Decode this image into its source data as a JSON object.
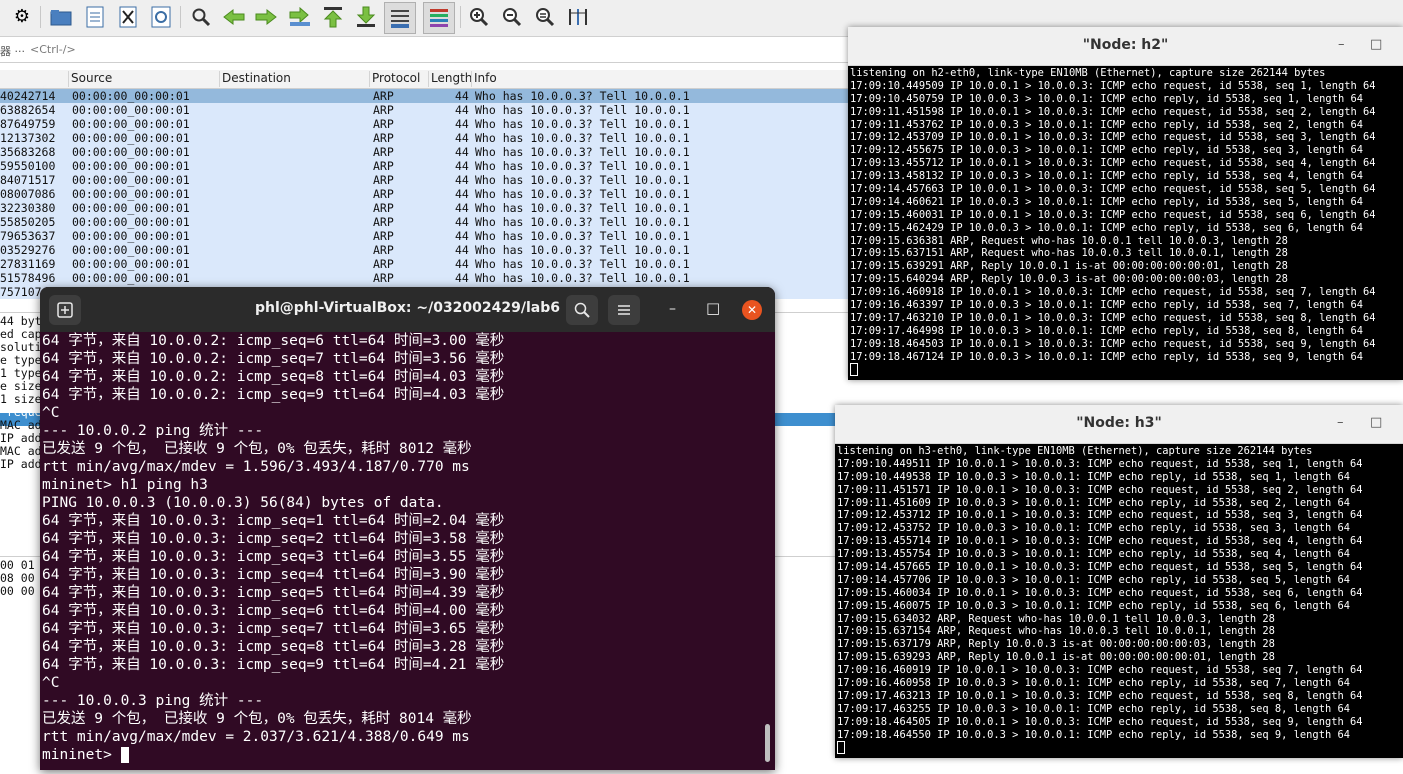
{
  "wireshark": {
    "toolbar_icons": [
      "gear-icon",
      "open-folder-icon",
      "file-icon",
      "close-file-icon",
      "reload-icon",
      "search-icon",
      "arrow-left-icon",
      "arrow-right-icon",
      "go-to-packet-icon",
      "first-packet-icon",
      "last-packet-icon",
      "autoscroll-icon",
      "colorize-icon",
      "zoom-in-icon",
      "zoom-out-icon",
      "zoom-reset-icon",
      "resize-columns-icon"
    ],
    "filter_prefix": "器 ···",
    "filter_placeholder": "<Ctrl-/>",
    "columns": {
      "source": "Source",
      "destination": "Destination",
      "protocol": "Protocol",
      "length": "Length",
      "info": "Info"
    },
    "packets": [
      {
        "time": "40242714",
        "src": "00:00:00_00:00:01",
        "proto": "ARP",
        "len": "44",
        "info": "Who has 10.0.0.3? Tell 10.0.0.1"
      },
      {
        "time": "63882654",
        "src": "00:00:00_00:00:01",
        "proto": "ARP",
        "len": "44",
        "info": "Who has 10.0.0.3? Tell 10.0.0.1"
      },
      {
        "time": "87649759",
        "src": "00:00:00_00:00:01",
        "proto": "ARP",
        "len": "44",
        "info": "Who has 10.0.0.3? Tell 10.0.0.1"
      },
      {
        "time": "12137302",
        "src": "00:00:00_00:00:01",
        "proto": "ARP",
        "len": "44",
        "info": "Who has 10.0.0.3? Tell 10.0.0.1"
      },
      {
        "time": "35683268",
        "src": "00:00:00_00:00:01",
        "proto": "ARP",
        "len": "44",
        "info": "Who has 10.0.0.3? Tell 10.0.0.1"
      },
      {
        "time": "59550100",
        "src": "00:00:00_00:00:01",
        "proto": "ARP",
        "len": "44",
        "info": "Who has 10.0.0.3? Tell 10.0.0.1"
      },
      {
        "time": "84071517",
        "src": "00:00:00_00:00:01",
        "proto": "ARP",
        "len": "44",
        "info": "Who has 10.0.0.3? Tell 10.0.0.1"
      },
      {
        "time": "08007086",
        "src": "00:00:00_00:00:01",
        "proto": "ARP",
        "len": "44",
        "info": "Who has 10.0.0.3? Tell 10.0.0.1"
      },
      {
        "time": "32230380",
        "src": "00:00:00_00:00:01",
        "proto": "ARP",
        "len": "44",
        "info": "Who has 10.0.0.3? Tell 10.0.0.1"
      },
      {
        "time": "55850205",
        "src": "00:00:00_00:00:01",
        "proto": "ARP",
        "len": "44",
        "info": "Who has 10.0.0.3? Tell 10.0.0.1"
      },
      {
        "time": "79653637",
        "src": "00:00:00_00:00:01",
        "proto": "ARP",
        "len": "44",
        "info": "Who has 10.0.0.3? Tell 10.0.0.1"
      },
      {
        "time": "03529276",
        "src": "00:00:00_00:00:01",
        "proto": "ARP",
        "len": "44",
        "info": "Who has 10.0.0.3? Tell 10.0.0.1"
      },
      {
        "time": "27831169",
        "src": "00:00:00_00:00:01",
        "proto": "ARP",
        "len": "44",
        "info": "Who has 10.0.0.3? Tell 10.0.0.1"
      },
      {
        "time": "51578496",
        "src": "00:00:00_00:00:01",
        "proto": "ARP",
        "len": "44",
        "info": "Who has 10.0.0.3? Tell 10.0.0.1"
      },
      {
        "time": "757107",
        "src": "",
        "proto": "",
        "len": "",
        "info": ""
      }
    ],
    "detail_lines": [
      "44 byt",
      "ed cap",
      "soluti",
      "e type",
      "1 type",
      "e size",
      "1 size",
      " reque",
      "MAC ad",
      "IP add",
      "MAC ad",
      "IP add"
    ],
    "bytes_lines": [
      "00 01 0",
      "08 00 0",
      "00 00 0"
    ]
  },
  "node_h2": {
    "title": "\"Node: h2\"",
    "lines": [
      "listening on h2-eth0, link-type EN10MB (Ethernet), capture size 262144 bytes",
      "17:09:10.449509 IP 10.0.0.1 > 10.0.0.3: ICMP echo request, id 5538, seq 1, length 64",
      "17:09:10.450759 IP 10.0.0.3 > 10.0.0.1: ICMP echo reply, id 5538, seq 1, length 64",
      "17:09:11.451598 IP 10.0.0.1 > 10.0.0.3: ICMP echo request, id 5538, seq 2, length 64",
      "17:09:11.453762 IP 10.0.0.3 > 10.0.0.1: ICMP echo reply, id 5538, seq 2, length 64",
      "17:09:12.453709 IP 10.0.0.1 > 10.0.0.3: ICMP echo request, id 5538, seq 3, length 64",
      "17:09:12.455675 IP 10.0.0.3 > 10.0.0.1: ICMP echo reply, id 5538, seq 3, length 64",
      "17:09:13.455712 IP 10.0.0.1 > 10.0.0.3: ICMP echo request, id 5538, seq 4, length 64",
      "17:09:13.458132 IP 10.0.0.3 > 10.0.0.1: ICMP echo reply, id 5538, seq 4, length 64",
      "17:09:14.457663 IP 10.0.0.1 > 10.0.0.3: ICMP echo request, id 5538, seq 5, length 64",
      "17:09:14.460621 IP 10.0.0.3 > 10.0.0.1: ICMP echo reply, id 5538, seq 5, length 64",
      "17:09:15.460031 IP 10.0.0.1 > 10.0.0.3: ICMP echo request, id 5538, seq 6, length 64",
      "17:09:15.462429 IP 10.0.0.3 > 10.0.0.1: ICMP echo reply, id 5538, seq 6, length 64",
      "17:09:15.636381 ARP, Request who-has 10.0.0.1 tell 10.0.0.3, length 28",
      "17:09:15.637151 ARP, Request who-has 10.0.0.3 tell 10.0.0.1, length 28",
      "17:09:15.639291 ARP, Reply 10.0.0.1 is-at 00:00:00:00:00:01, length 28",
      "17:09:15.640294 ARP, Reply 10.0.0.3 is-at 00:00:00:00:00:03, length 28",
      "17:09:16.460918 IP 10.0.0.1 > 10.0.0.3: ICMP echo request, id 5538, seq 7, length 64",
      "17:09:16.463397 IP 10.0.0.3 > 10.0.0.1: ICMP echo reply, id 5538, seq 7, length 64",
      "17:09:17.463210 IP 10.0.0.1 > 10.0.0.3: ICMP echo request, id 5538, seq 8, length 64",
      "17:09:17.464998 IP 10.0.0.3 > 10.0.0.1: ICMP echo reply, id 5538, seq 8, length 64",
      "17:09:18.464503 IP 10.0.0.1 > 10.0.0.3: ICMP echo request, id 5538, seq 9, length 64",
      "17:09:18.467124 IP 10.0.0.3 > 10.0.0.1: ICMP echo reply, id 5538, seq 9, length 64"
    ]
  },
  "node_h3": {
    "title": "\"Node: h3\"",
    "lines": [
      "listening on h3-eth0, link-type EN10MB (Ethernet), capture size 262144 bytes",
      "17:09:10.449511 IP 10.0.0.1 > 10.0.0.3: ICMP echo request, id 5538, seq 1, length 64",
      "17:09:10.449538 IP 10.0.0.3 > 10.0.0.1: ICMP echo reply, id 5538, seq 1, length 64",
      "17:09:11.451571 IP 10.0.0.1 > 10.0.0.3: ICMP echo request, id 5538, seq 2, length 64",
      "17:09:11.451609 IP 10.0.0.3 > 10.0.0.1: ICMP echo reply, id 5538, seq 2, length 64",
      "17:09:12.453712 IP 10.0.0.1 > 10.0.0.3: ICMP echo request, id 5538, seq 3, length 64",
      "17:09:12.453752 IP 10.0.0.3 > 10.0.0.1: ICMP echo reply, id 5538, seq 3, length 64",
      "17:09:13.455714 IP 10.0.0.1 > 10.0.0.3: ICMP echo request, id 5538, seq 4, length 64",
      "17:09:13.455754 IP 10.0.0.3 > 10.0.0.1: ICMP echo reply, id 5538, seq 4, length 64",
      "17:09:14.457665 IP 10.0.0.1 > 10.0.0.3: ICMP echo request, id 5538, seq 5, length 64",
      "17:09:14.457706 IP 10.0.0.3 > 10.0.0.1: ICMP echo reply, id 5538, seq 5, length 64",
      "17:09:15.460034 IP 10.0.0.1 > 10.0.0.3: ICMP echo request, id 5538, seq 6, length 64",
      "17:09:15.460075 IP 10.0.0.3 > 10.0.0.1: ICMP echo reply, id 5538, seq 6, length 64",
      "17:09:15.634032 ARP, Request who-has 10.0.0.1 tell 10.0.0.3, length 28",
      "17:09:15.637154 ARP, Request who-has 10.0.0.3 tell 10.0.0.1, length 28",
      "17:09:15.637179 ARP, Reply 10.0.0.3 is-at 00:00:00:00:00:03, length 28",
      "17:09:15.639293 ARP, Reply 10.0.0.1 is-at 00:00:00:00:00:01, length 28",
      "17:09:16.460919 IP 10.0.0.1 > 10.0.0.3: ICMP echo request, id 5538, seq 7, length 64",
      "17:09:16.460958 IP 10.0.0.3 > 10.0.0.1: ICMP echo reply, id 5538, seq 7, length 64",
      "17:09:17.463213 IP 10.0.0.1 > 10.0.0.3: ICMP echo request, id 5538, seq 8, length 64",
      "17:09:17.463255 IP 10.0.0.3 > 10.0.0.1: ICMP echo reply, id 5538, seq 8, length 64",
      "17:09:18.464505 IP 10.0.0.1 > 10.0.0.3: ICMP echo request, id 5538, seq 9, length 64",
      "17:09:18.464550 IP 10.0.0.3 > 10.0.0.1: ICMP echo reply, id 5538, seq 9, length 64"
    ]
  },
  "terminal": {
    "title": "phl@phl-VirtualBox: ~/032002429/lab6",
    "lines": [
      "64 字节，来自 10.0.0.2: icmp_seq=6 ttl=64 时间=3.00 毫秒",
      "64 字节，来自 10.0.0.2: icmp_seq=7 ttl=64 时间=3.56 毫秒",
      "64 字节，来自 10.0.0.2: icmp_seq=8 ttl=64 时间=4.03 毫秒",
      "64 字节，来自 10.0.0.2: icmp_seq=9 ttl=64 时间=4.03 毫秒",
      "^C",
      "--- 10.0.0.2 ping 统计 ---",
      "已发送 9 个包， 已接收 9 个包，0% 包丢失，耗时 8012 毫秒",
      "rtt min/avg/max/mdev = 1.596/3.493/4.187/0.770 ms",
      "mininet> h1 ping h3",
      "PING 10.0.0.3 (10.0.0.3) 56(84) bytes of data.",
      "64 字节，来自 10.0.0.3: icmp_seq=1 ttl=64 时间=2.04 毫秒",
      "64 字节，来自 10.0.0.3: icmp_seq=2 ttl=64 时间=3.58 毫秒",
      "64 字节，来自 10.0.0.3: icmp_seq=3 ttl=64 时间=3.55 毫秒",
      "64 字节，来自 10.0.0.3: icmp_seq=4 ttl=64 时间=3.90 毫秒",
      "64 字节，来自 10.0.0.3: icmp_seq=5 ttl=64 时间=4.39 毫秒",
      "64 字节，来自 10.0.0.3: icmp_seq=6 ttl=64 时间=4.00 毫秒",
      "64 字节，来自 10.0.0.3: icmp_seq=7 ttl=64 时间=3.65 毫秒",
      "64 字节，来自 10.0.0.3: icmp_seq=8 ttl=64 时间=3.28 毫秒",
      "64 字节，来自 10.0.0.3: icmp_seq=9 ttl=64 时间=4.21 毫秒",
      "^C",
      "--- 10.0.0.3 ping 统计 ---",
      "已发送 9 个包， 已接收 9 个包，0% 包丢失，耗时 8014 毫秒",
      "rtt min/avg/max/mdev = 2.037/3.621/4.388/0.649 ms"
    ],
    "prompt": "mininet> "
  }
}
